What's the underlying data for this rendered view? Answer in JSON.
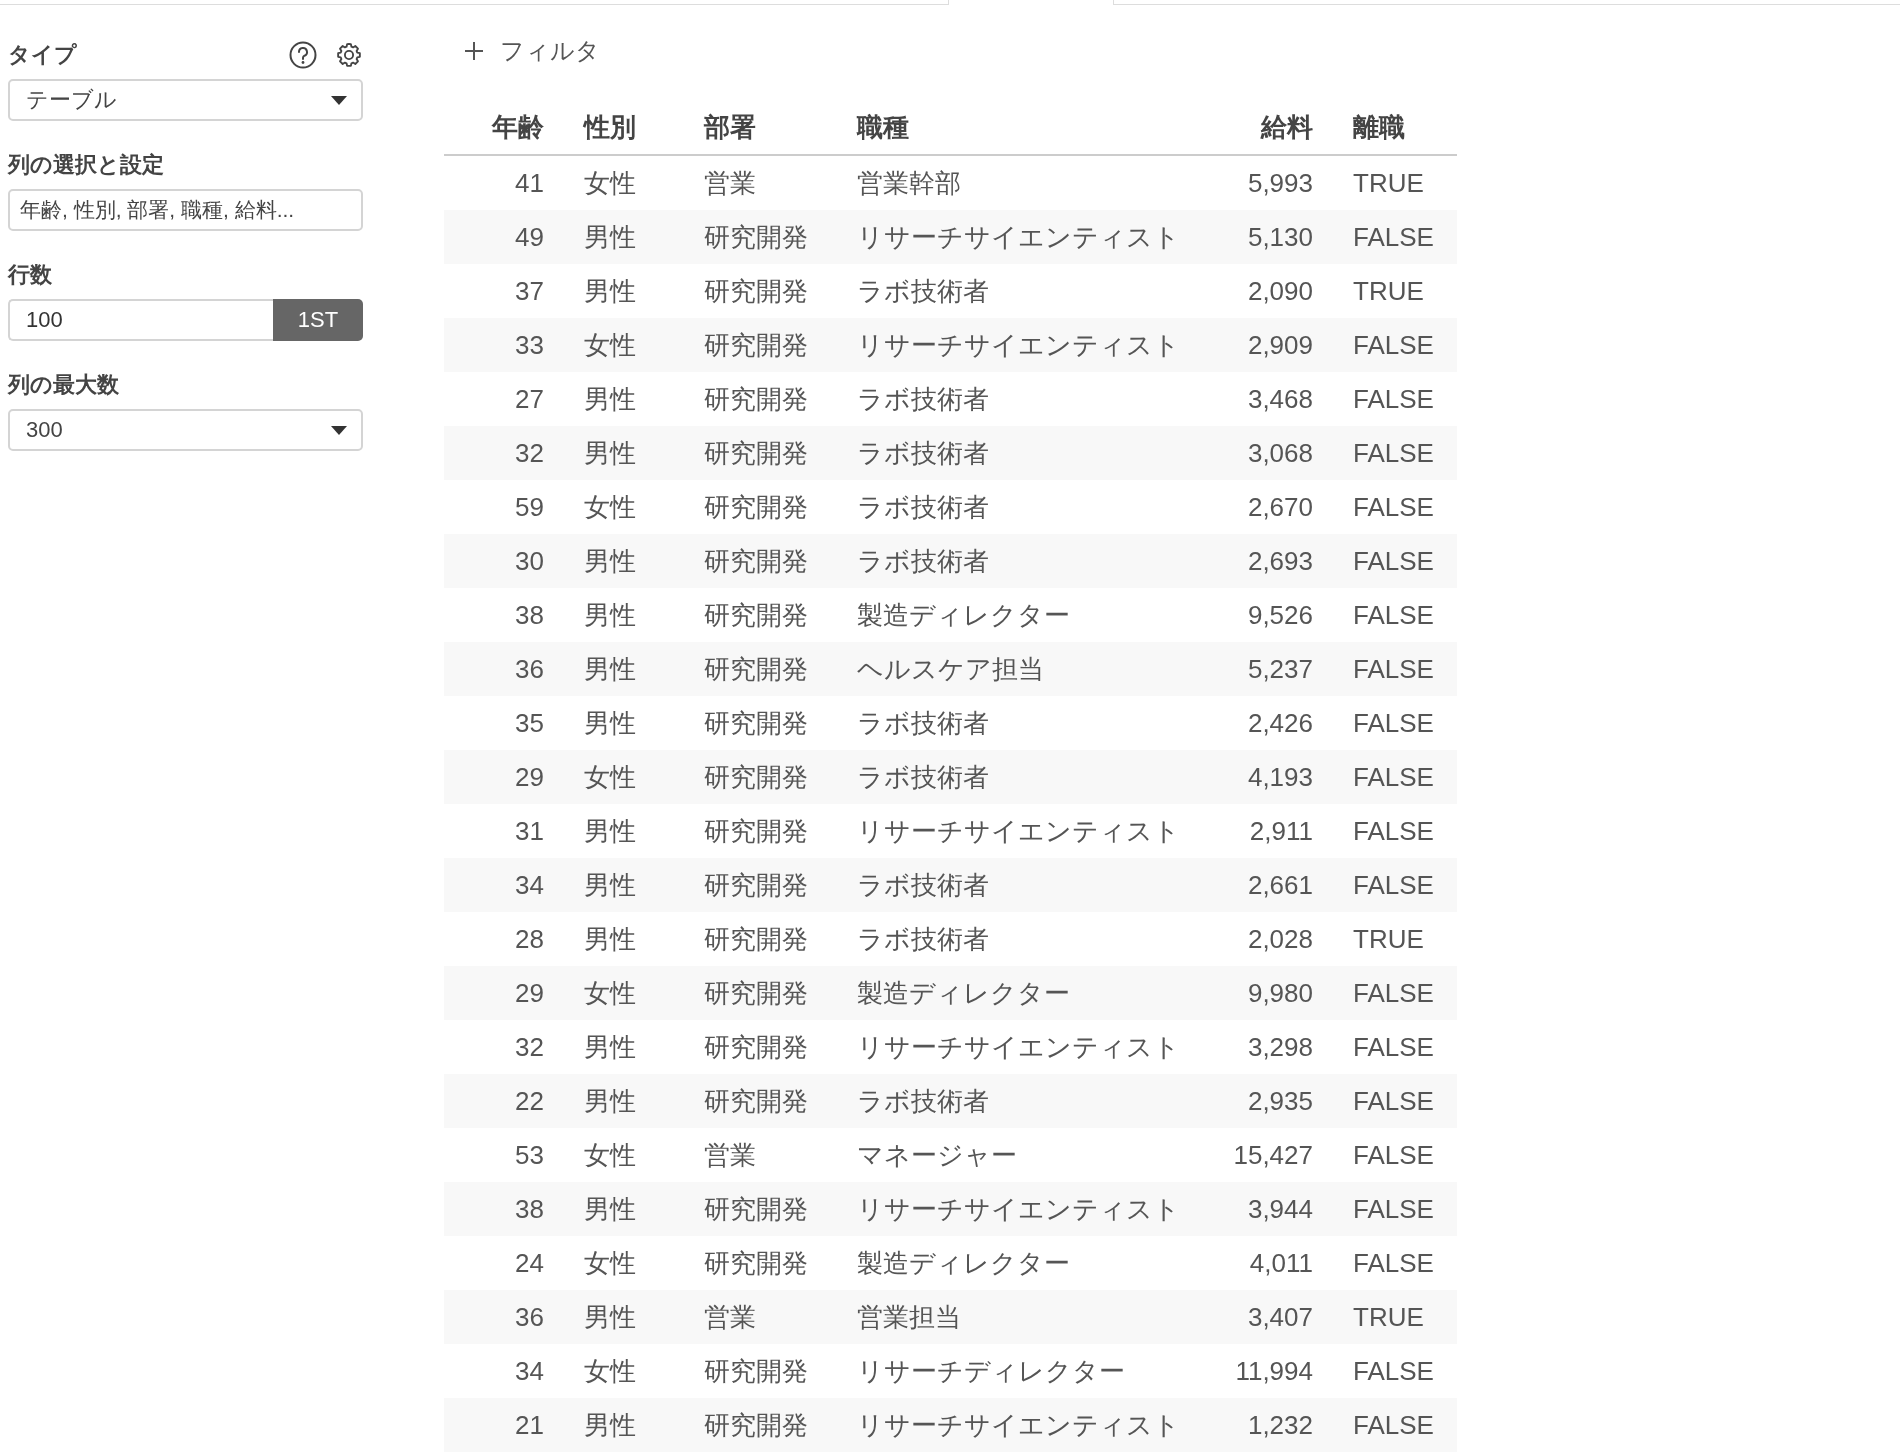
{
  "sidebar": {
    "fields": [
      {
        "kind": "select",
        "label": "タイプ",
        "value": "テーブル",
        "help": true,
        "settings": true
      },
      {
        "kind": "text",
        "label": "列の選択と設定",
        "value": "年齢, 性別, 部署, 職種, 給料..."
      },
      {
        "kind": "number",
        "label": "行数",
        "value": "100",
        "button": "1ST"
      },
      {
        "kind": "select",
        "label": "列の最大数",
        "value": "300"
      }
    ]
  },
  "filter": {
    "label": "フィルタ"
  },
  "table": {
    "columns": [
      {
        "label": "年齢",
        "kind": "number"
      },
      {
        "label": "性別",
        "kind": "text"
      },
      {
        "label": "部署",
        "kind": "text"
      },
      {
        "label": "職種",
        "kind": "text"
      },
      {
        "label": "給料",
        "kind": "number"
      },
      {
        "label": "離職",
        "kind": "text"
      }
    ],
    "rows": [
      [
        "41",
        "女性",
        "営業",
        "営業幹部",
        "5,993",
        "TRUE"
      ],
      [
        "49",
        "男性",
        "研究開発",
        "リサーチサイエンティスト",
        "5,130",
        "FALSE"
      ],
      [
        "37",
        "男性",
        "研究開発",
        "ラボ技術者",
        "2,090",
        "TRUE"
      ],
      [
        "33",
        "女性",
        "研究開発",
        "リサーチサイエンティスト",
        "2,909",
        "FALSE"
      ],
      [
        "27",
        "男性",
        "研究開発",
        "ラボ技術者",
        "3,468",
        "FALSE"
      ],
      [
        "32",
        "男性",
        "研究開発",
        "ラボ技術者",
        "3,068",
        "FALSE"
      ],
      [
        "59",
        "女性",
        "研究開発",
        "ラボ技術者",
        "2,670",
        "FALSE"
      ],
      [
        "30",
        "男性",
        "研究開発",
        "ラボ技術者",
        "2,693",
        "FALSE"
      ],
      [
        "38",
        "男性",
        "研究開発",
        "製造ディレクター",
        "9,526",
        "FALSE"
      ],
      [
        "36",
        "男性",
        "研究開発",
        "ヘルスケア担当",
        "5,237",
        "FALSE"
      ],
      [
        "35",
        "男性",
        "研究開発",
        "ラボ技術者",
        "2,426",
        "FALSE"
      ],
      [
        "29",
        "女性",
        "研究開発",
        "ラボ技術者",
        "4,193",
        "FALSE"
      ],
      [
        "31",
        "男性",
        "研究開発",
        "リサーチサイエンティスト",
        "2,911",
        "FALSE"
      ],
      [
        "34",
        "男性",
        "研究開発",
        "ラボ技術者",
        "2,661",
        "FALSE"
      ],
      [
        "28",
        "男性",
        "研究開発",
        "ラボ技術者",
        "2,028",
        "TRUE"
      ],
      [
        "29",
        "女性",
        "研究開発",
        "製造ディレクター",
        "9,980",
        "FALSE"
      ],
      [
        "32",
        "男性",
        "研究開発",
        "リサーチサイエンティスト",
        "3,298",
        "FALSE"
      ],
      [
        "22",
        "男性",
        "研究開発",
        "ラボ技術者",
        "2,935",
        "FALSE"
      ],
      [
        "53",
        "女性",
        "営業",
        "マネージャー",
        "15,427",
        "FALSE"
      ],
      [
        "38",
        "男性",
        "研究開発",
        "リサーチサイエンティスト",
        "3,944",
        "FALSE"
      ],
      [
        "24",
        "女性",
        "研究開発",
        "製造ディレクター",
        "4,011",
        "FALSE"
      ],
      [
        "36",
        "男性",
        "営業",
        "営業担当",
        "3,407",
        "TRUE"
      ],
      [
        "34",
        "女性",
        "研究開発",
        "リサーチディレクター",
        "11,994",
        "FALSE"
      ],
      [
        "21",
        "男性",
        "研究開発",
        "リサーチサイエンティスト",
        "1,232",
        "FALSE"
      ]
    ]
  }
}
